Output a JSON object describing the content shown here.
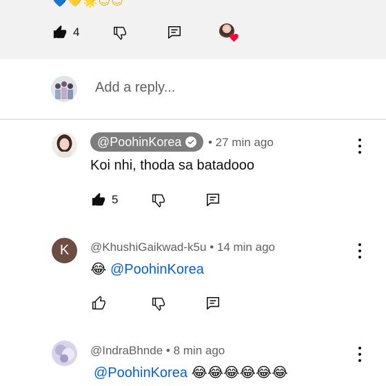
{
  "top": {
    "emoji_row": "💙💛🌟😊😊",
    "like_count": "4"
  },
  "reply_box": {
    "placeholder": "Add a reply..."
  },
  "comments": [
    {
      "handle": "@PoohinKorea",
      "time": "• 27 min ago",
      "text": "Koi nhi, thoda sa batadooo",
      "like_count": "5",
      "creator": true
    },
    {
      "avatar_letter": "K",
      "handle": "@KhushiGaikwad-k5u",
      "time": "• 14 min ago",
      "emoji": "😂",
      "mention": "@PoohinKorea",
      "avatar_color": "#6d4c41"
    },
    {
      "handle": "@IndraBhnde",
      "time": "• 8 min ago",
      "mention": "@PoohinKorea",
      "emoji_trail": "😂😂😂😂😂😂"
    }
  ],
  "icons": {
    "like": "thumbs-up-icon",
    "dislike": "thumbs-down-icon",
    "reply": "comment-icon",
    "heart": "heart-icon",
    "more": "more-vert-icon"
  },
  "colors": {
    "link": "#065fd4",
    "creator_pill": "#7d7d7d",
    "heart": "#ff0033"
  }
}
